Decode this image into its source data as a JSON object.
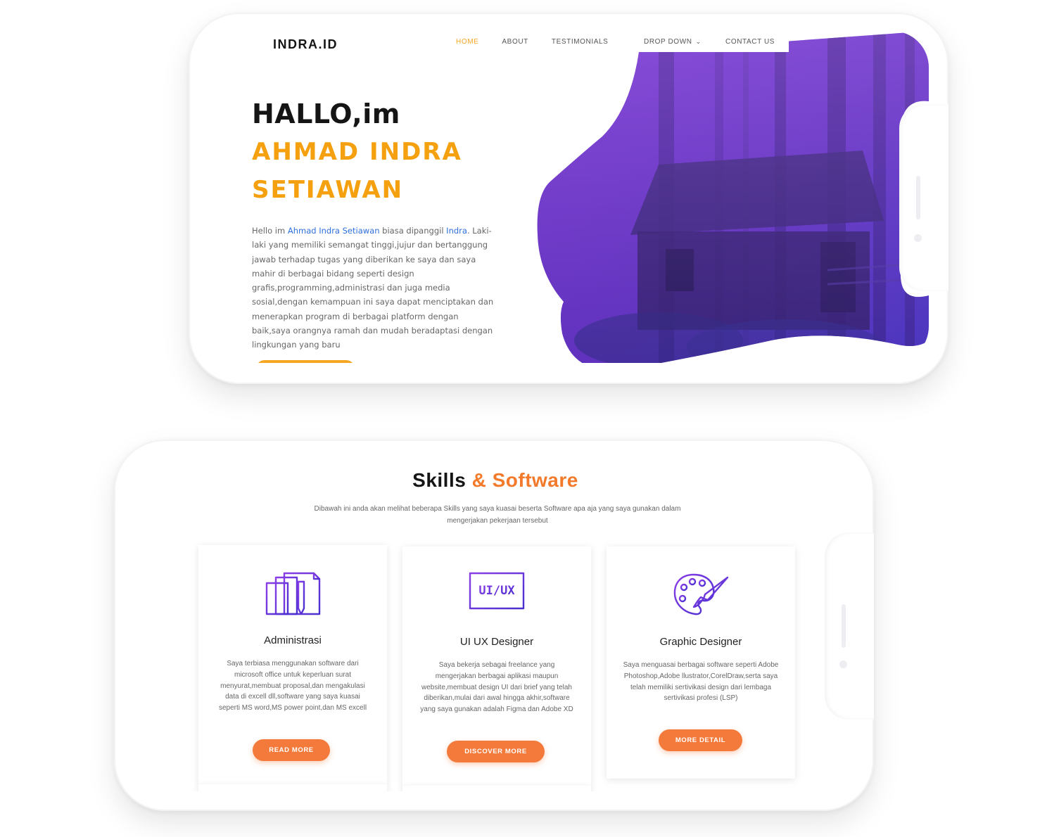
{
  "hero": {
    "logo": "INDRA.ID",
    "nav": {
      "home": "HOME",
      "about": "ABOUT",
      "testimonials": "TESTIMONIALS",
      "dropdown": "DROP DOWN",
      "contact": "CONTACT US"
    },
    "greeting": "HALLO,im",
    "name_line1": "AHMAD INDRA",
    "name_line2": "SETIAWAN",
    "bio": {
      "p1": "Hello im ",
      "full_name": "Ahmad Indra Setiawan",
      "p2": " biasa dipanggil ",
      "nickname": "Indra",
      "p3": ". Laki-laki yang memiliki semangat tinggi,jujur dan bertanggung jawab terhadap tugas yang diberikan ke saya dan saya mahir di berbagai bidang seperti design grafis,programming,administrasi dan juga media sosial,dengan kemampuan ini saya dapat menciptakan dan menerapkan program di berbagai platform dengan baik,saya orangnya ramah dan mudah beradaptasi dengan lingkungan yang baru"
    },
    "colors": {
      "accent": "#f5a623",
      "link": "#2f6fdc",
      "blob_purple": "#6b2fd6",
      "blob_violet": "#8a3ad8"
    }
  },
  "skills": {
    "title_main": "Skills",
    "title_accent": "& Software",
    "subtitle": "Dibawah ini anda akan melihat beberapa Skills yang saya kuasai beserta Software apa aja yang saya gunakan dalam mengerjakan pekerjaan tersebut",
    "cards": [
      {
        "icon": "documents-icon",
        "title": "Administrasi",
        "text": "Saya terbiasa menggunakan software dari microsoft office untuk keperluan surat menyurat,membuat proposal,dan mengakulasi data di excell dll,software yang saya kuasai seperti MS word,MS power point,dan MS excell",
        "button": "READ MORE"
      },
      {
        "icon": "ui-ux-monitor-icon",
        "icon_text": "UI/UX",
        "title": "UI UX Designer",
        "text": "Saya bekerja sebagai freelance yang mengerjakan berbagai aplikasi maupun website,membuat design UI dari brief yang telah diberikan,mulai dari awal hingga akhir,software yang saya gunakan adalah Figma dan Adobe XD",
        "button": "DISCOVER MORE"
      },
      {
        "icon": "palette-brush-icon",
        "title": "Graphic Designer",
        "text": "Saya menguasai berbagai software seperti Adobe Photoshop,Adobe llustrator,CorelDraw,serta saya telah memiliki sertivikasi design dari lembaga sertivikasi profesi (LSP)",
        "button": "MORE DETAIL"
      }
    ],
    "colors": {
      "accent": "#f37a2a",
      "icon_start": "#7b3fe4",
      "icon_end": "#4a2fd0"
    }
  }
}
